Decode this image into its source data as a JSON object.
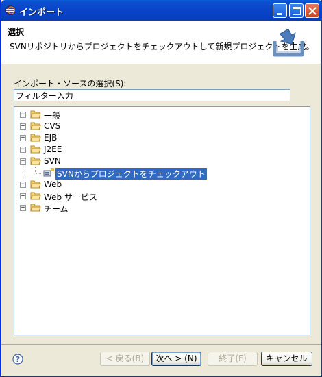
{
  "window": {
    "title": "インポート"
  },
  "header": {
    "title": "選択",
    "description": "SVNリポジトリからプロジェクトをチェックアウトして新規プロジェクトを生成。",
    "icon": "import-wizard-icon"
  },
  "source": {
    "label": "インポート・ソースの選択(S):",
    "filter_value": "フィルター入力"
  },
  "tree": {
    "items": [
      {
        "label": "一般",
        "expanded": false
      },
      {
        "label": "CVS",
        "expanded": false
      },
      {
        "label": "EJB",
        "expanded": false
      },
      {
        "label": "J2EE",
        "expanded": false
      },
      {
        "label": "SVN",
        "expanded": true,
        "children": [
          {
            "label": "SVNからプロジェクトをチェックアウト",
            "selected": true
          }
        ]
      },
      {
        "label": "Web",
        "expanded": false
      },
      {
        "label": "Web サービス",
        "expanded": false
      },
      {
        "label": "チーム",
        "expanded": false
      }
    ]
  },
  "buttons": {
    "back": "< 戻る(B)",
    "next": "次へ > (N)",
    "finish": "終了(F)",
    "cancel": "キャンセル"
  },
  "colors": {
    "titlebar": "#0a44c8",
    "selection": "#316ac5",
    "window_bg": "#ece9d8"
  }
}
